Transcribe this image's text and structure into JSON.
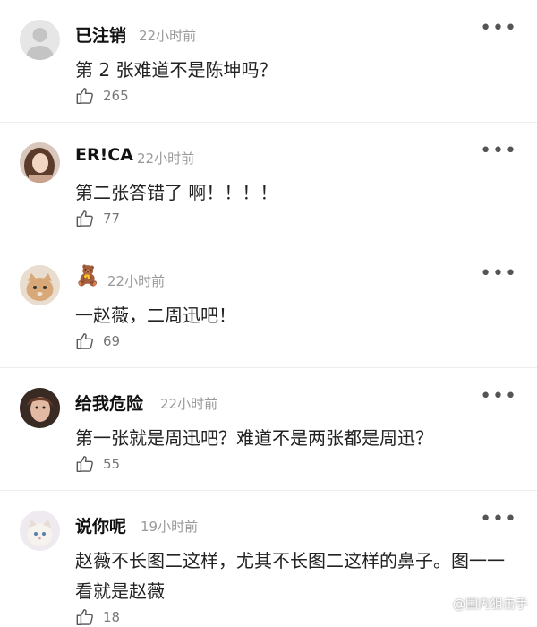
{
  "comments": [
    {
      "name": "已注销",
      "time": "22小时前",
      "text": "第 2 张难道不是陈坤吗？",
      "likes": "265",
      "avatar": "default-avatar"
    },
    {
      "name": "ER!CA",
      "time": "22小时前",
      "text": "第二张答错了 啊！！！！",
      "likes": "77",
      "avatar": "user-avatar-girl"
    },
    {
      "name": "🧸",
      "time": "22小时前",
      "text": "一赵薇，二周迅吧！",
      "likes": "69",
      "avatar": "user-avatar-cat"
    },
    {
      "name": "给我危险",
      "time": "22小时前",
      "text": "第一张就是周迅吧？难道不是两张都是周迅？",
      "likes": "55",
      "avatar": "user-avatar-woman"
    },
    {
      "name": "说你呢",
      "time": "19小时前",
      "text": "赵薇不长图二这样，尤其不长图二这样的鼻子。图一一看就是赵薇",
      "likes": "18",
      "avatar": "user-avatar-kitten"
    }
  ],
  "more_label": "•••",
  "watermark": "@国内狙击手"
}
